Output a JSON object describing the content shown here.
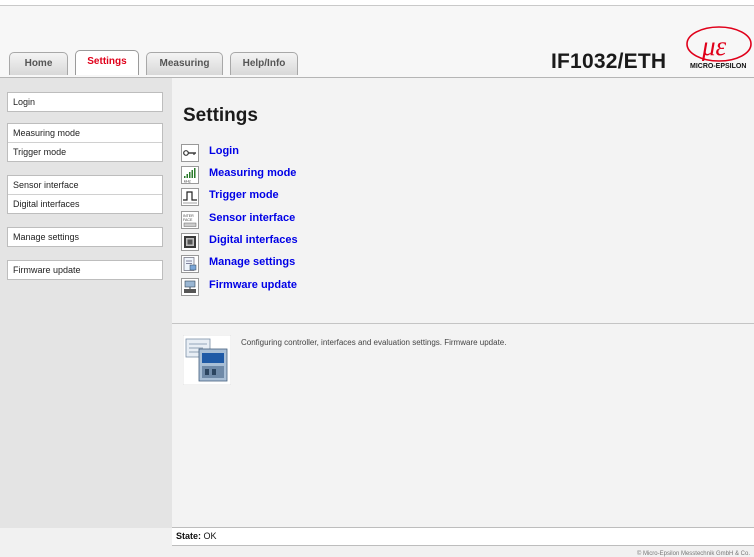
{
  "tabs": [
    {
      "label": "Home",
      "active": false
    },
    {
      "label": "Settings",
      "active": true
    },
    {
      "label": "Measuring",
      "active": false
    },
    {
      "label": "Help/Info",
      "active": false
    }
  ],
  "header": {
    "device_title": "IF1032/ETH",
    "logo_text": "MICRO-EPSILON"
  },
  "sidebar": {
    "groups": [
      [
        "Login"
      ],
      [
        "Measuring mode",
        "Trigger mode"
      ],
      [
        "Sensor interface",
        "Digital interfaces"
      ],
      [
        "Manage settings"
      ],
      [
        "Firmware update"
      ]
    ]
  },
  "main": {
    "title": "Settings",
    "links": [
      {
        "label": "Login",
        "icon": "key-icon"
      },
      {
        "label": "Measuring mode",
        "icon": "signal-khz-icon"
      },
      {
        "label": "Trigger mode",
        "icon": "trigger-pulse-icon"
      },
      {
        "label": "Sensor interface",
        "icon": "interface-card-icon"
      },
      {
        "label": "Digital interfaces",
        "icon": "digital-port-icon"
      },
      {
        "label": "Manage settings",
        "icon": "settings-file-icon"
      },
      {
        "label": "Firmware update",
        "icon": "firmware-chip-icon"
      }
    ],
    "description": "Configuring controller, interfaces and evaluation settings. Firmware update."
  },
  "status": {
    "label": "State:",
    "value": "OK"
  },
  "footer": {
    "copyright": "© Micro-Epsilon Messtechnik GmbH & Co."
  },
  "colors": {
    "active_tab": "#e0001a",
    "link": "#0000e6",
    "logo": "#e0001a"
  }
}
